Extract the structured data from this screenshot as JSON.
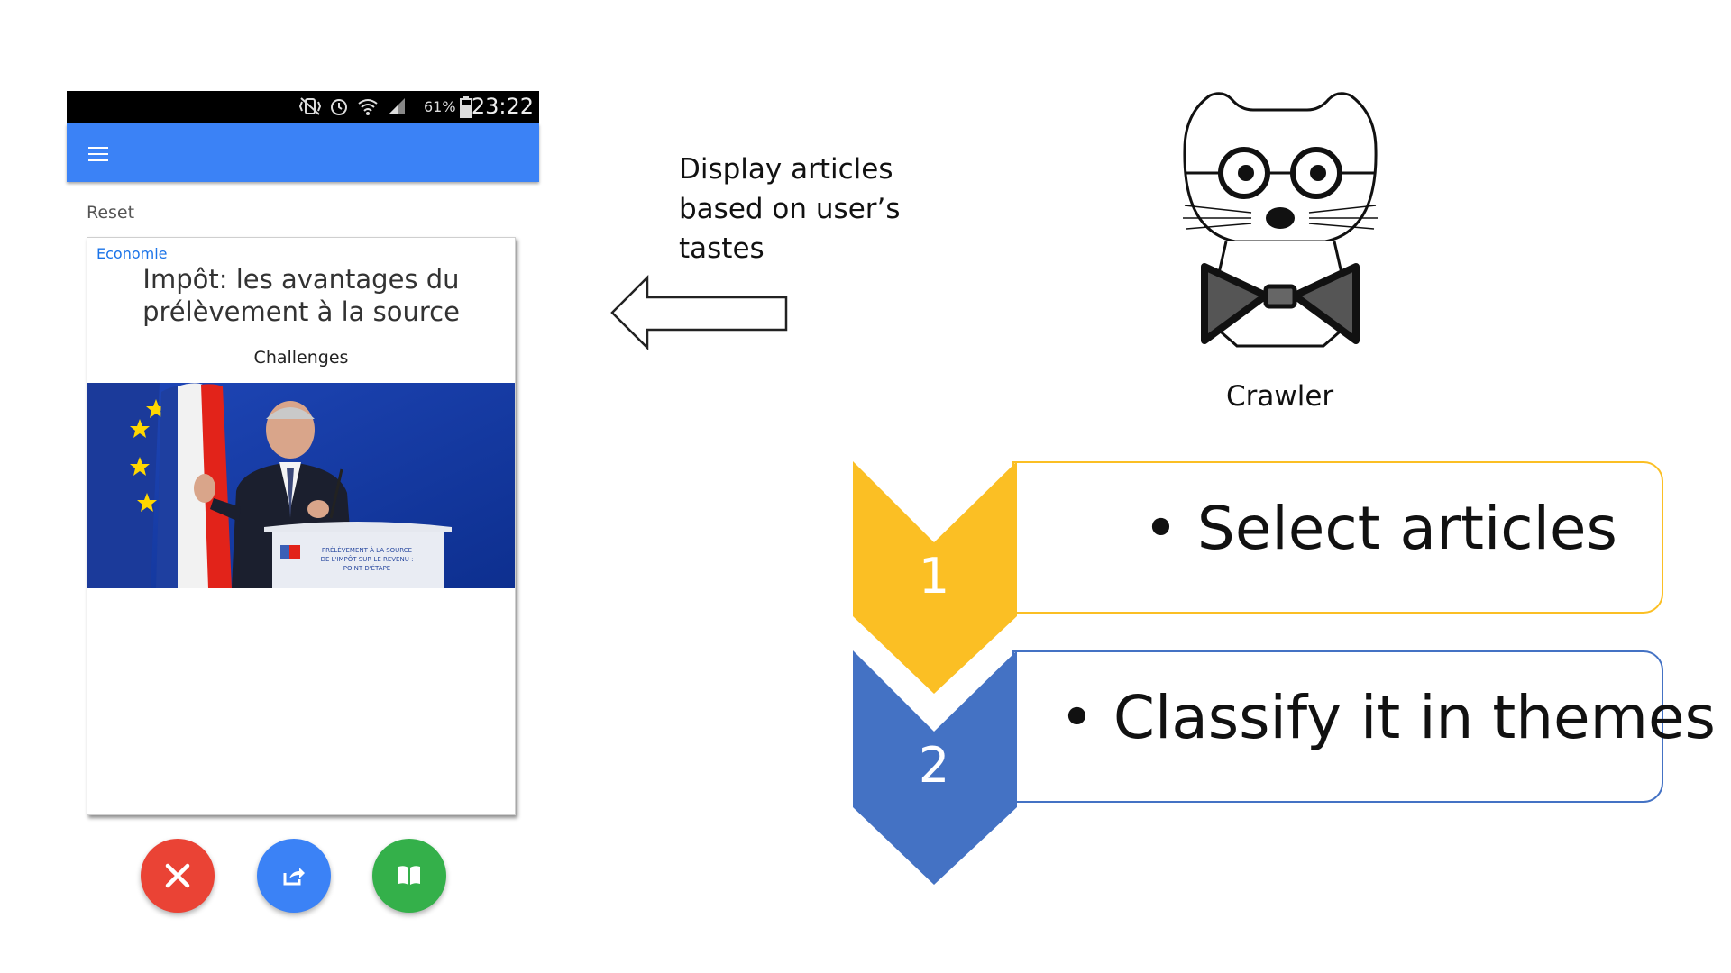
{
  "phone": {
    "status_bar": {
      "battery": "61%",
      "time": "23:22"
    },
    "reset_label": "Reset",
    "article": {
      "category": "Economie",
      "title_line1": "Impôt: les avantages du",
      "title_line2": "prélèvement à la source",
      "source": "Challenges",
      "podium_line1": "PRÉLÈVEMENT À LA SOURCE",
      "podium_line2": "DE L'IMPÔT SUR LE REVENU :",
      "podium_line3": "POINT D'ÉTAPE"
    },
    "actions": [
      {
        "icon": "close-icon",
        "color": "#ea4335"
      },
      {
        "icon": "share-icon",
        "color": "#3b82f6"
      },
      {
        "icon": "book-icon",
        "color": "#34b04a"
      }
    ]
  },
  "display_note": {
    "line1": "Display articles",
    "line2": "based on user’s",
    "line3": "tastes"
  },
  "crawler": {
    "label": "Crawler",
    "icon": "cat-with-glasses-and-bowtie-icon"
  },
  "steps": [
    {
      "number": "1",
      "text": "Select articles",
      "color": "#fbbf24"
    },
    {
      "number": "2",
      "text": "Classify it in themes",
      "color": "#4472c4"
    }
  ]
}
